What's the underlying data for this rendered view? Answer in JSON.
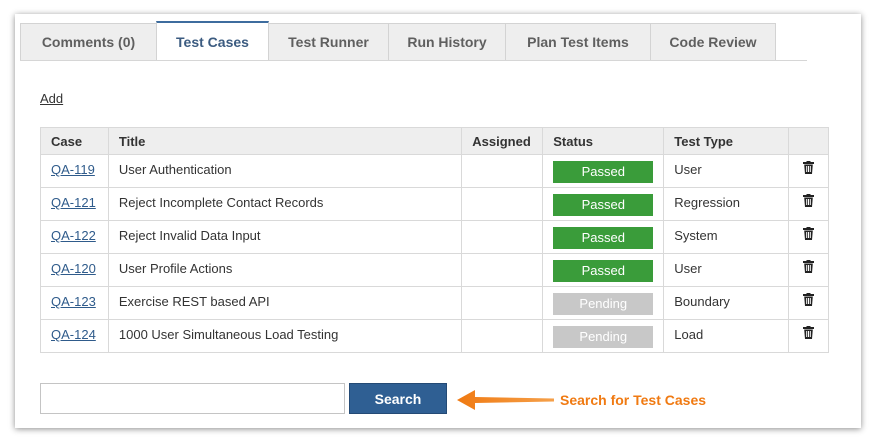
{
  "tabs": [
    {
      "label": "Comments (0)",
      "active": false
    },
    {
      "label": "Test Cases",
      "active": true
    },
    {
      "label": "Test Runner",
      "active": false
    },
    {
      "label": "Run History",
      "active": false
    },
    {
      "label": "Plan Test Items",
      "active": false
    },
    {
      "label": "Code Review",
      "active": false
    }
  ],
  "add_label": "Add",
  "table": {
    "headers": [
      "Case",
      "Title",
      "Assigned",
      "Status",
      "Test Type"
    ],
    "rows": [
      {
        "case": "QA-119",
        "title": "User Authentication",
        "assigned": "",
        "status": "Passed",
        "type": "User"
      },
      {
        "case": "QA-121",
        "title": "Reject Incomplete Contact Records",
        "assigned": "",
        "status": "Passed",
        "type": "Regression"
      },
      {
        "case": "QA-122",
        "title": "Reject Invalid Data Input",
        "assigned": "",
        "status": "Passed",
        "type": "System"
      },
      {
        "case": "QA-120",
        "title": "User Profile Actions",
        "assigned": "",
        "status": "Passed",
        "type": "User"
      },
      {
        "case": "QA-123",
        "title": "Exercise REST based API",
        "assigned": "",
        "status": "Pending",
        "type": "Boundary"
      },
      {
        "case": "QA-124",
        "title": "1000 User Simultaneous Load Testing",
        "assigned": "",
        "status": "Pending",
        "type": "Load"
      }
    ]
  },
  "search": {
    "value": "",
    "placeholder": "",
    "button_label": "Search"
  },
  "callout": "Search for Test Cases",
  "colors": {
    "accent": "#2f5f93",
    "passed": "#3a9c3a",
    "pending": "#c8c8c8",
    "callout": "#f07a12"
  },
  "icons": {
    "delete": "trash-icon",
    "pointer": "arrow-left-icon"
  }
}
